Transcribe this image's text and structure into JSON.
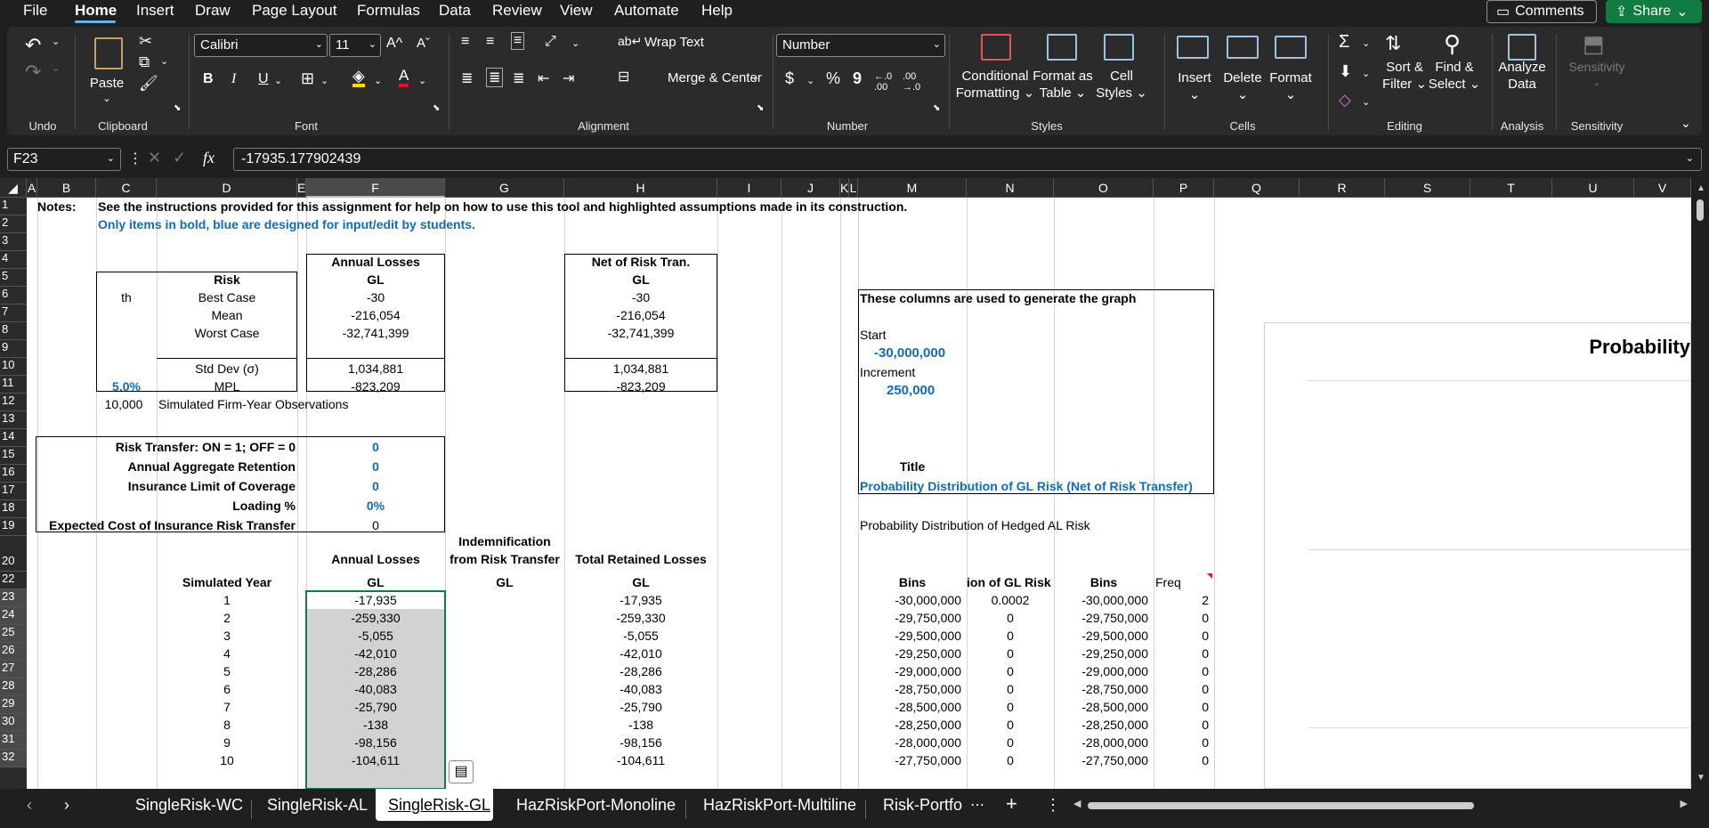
{
  "menu": {
    "items": [
      "File",
      "Home",
      "Insert",
      "Draw",
      "Page Layout",
      "Formulas",
      "Data",
      "Review",
      "View",
      "Automate",
      "Help"
    ],
    "active": "Home"
  },
  "top_buttons": {
    "comments": "Comments",
    "share": "Share"
  },
  "ribbon": {
    "groups": {
      "undo": "Undo",
      "clipboard": "Clipboard",
      "font": "Font",
      "alignment": "Alignment",
      "number": "Number",
      "styles": "Styles",
      "cells": "Cells",
      "editing": "Editing",
      "analysis": "Analysis",
      "sensitivity": "Sensitivity"
    },
    "paste": "Paste",
    "font_name": "Calibri",
    "font_size": "11",
    "bold": "B",
    "italic": "I",
    "underline": "U",
    "wrap_text": "Wrap Text",
    "merge_center": "Merge & Center",
    "number_format": "Number",
    "currency": "$",
    "percent": "%",
    "comma": "9",
    "conditional_formatting": [
      "Conditional",
      "Formatting"
    ],
    "format_as_table": [
      "Format as",
      "Table"
    ],
    "cell_styles": [
      "Cell",
      "Styles"
    ],
    "insert": "Insert",
    "delete": "Delete",
    "format": "Format",
    "sort_filter": [
      "Sort &",
      "Filter"
    ],
    "find_select": [
      "Find &",
      "Select"
    ],
    "analyze_data": [
      "Analyze",
      "Data"
    ],
    "sensitivity": "Sensitivity"
  },
  "formula_bar": {
    "name_box": "F23",
    "fx": "fx",
    "formula": "-17935.177902439"
  },
  "columns": [
    "A",
    "B",
    "C",
    "D",
    "E",
    "F",
    "G",
    "H",
    "I",
    "J",
    "K",
    "L",
    "M",
    "N",
    "O",
    "P",
    "Q",
    "R",
    "S",
    "T",
    "U",
    "V"
  ],
  "rows": [
    "1",
    "2",
    "3",
    "4",
    "5",
    "6",
    "7",
    "8",
    "9",
    "10",
    "11",
    "12",
    "13",
    "14",
    "15",
    "16",
    "17",
    "18",
    "19",
    "20",
    "22",
    "23",
    "24",
    "25",
    "26",
    "27",
    "28",
    "29",
    "30",
    "31",
    "32"
  ],
  "sheet": {
    "notes_label": "Notes:",
    "notes_line1": "See the instructions provided for this assignment  for help on how to use this tool and highlighted assumptions made in its construction.",
    "notes_line2": "Only items in bold, blue are designed for input/edit by  students.",
    "annual_losses": "Annual Losses",
    "gl": "GL",
    "net_risk_tran": "Net of Risk Tran.",
    "risk": "Risk",
    "th": "th",
    "best_case": "Best Case",
    "mean": "Mean",
    "worst_case": "Worst Case",
    "std_dev": "Std Dev (σ)",
    "mpl_pct": "5.0%",
    "mpl": "MPL",
    "best_val": "-30",
    "mean_val": "-216,054",
    "worst_val": "-32,741,399",
    "std_val": "1,034,881",
    "mpl_val": "-823,209",
    "sim_count": "10,000",
    "sim_label": "Simulated Firm-Year Observations",
    "rt_on_off": "Risk Transfer: ON = 1; OFF = 0",
    "aar": "Annual Aggregate Retention",
    "ilc": "Insurance Limit of Coverage",
    "loading": "Loading %",
    "ecirt": "Expected Cost of Insurance Risk Transfer",
    "rt_val": "0",
    "aar_val": "0",
    "ilc_val": "0",
    "loading_val": "0%",
    "ecirt_val": "0",
    "graph_note": "These columns are used to generate the graph",
    "start": "Start",
    "start_val": "-30,000,000",
    "increment": "Increment",
    "increment_val": "250,000",
    "title_label": "Title",
    "title_val": "Probability Distribution of GL Risk (Net of Risk Transfer)",
    "hedged_al": "Probability Distribution of Hedged AL Risk",
    "indemnification": "Indemnification",
    "from_risk_transfer": "from Risk Transfer",
    "total_retained": "Total Retained Losses",
    "simulated_year": "Simulated Year",
    "bins": "Bins",
    "gl_risk_trunc": "ion of GL Risk (",
    "freq": "Freq",
    "chart_title": "Probability"
  },
  "table_rows": [
    {
      "year": "1",
      "annual": "-17,935",
      "total": "-17,935",
      "bin": "-30,000,000",
      "prob": "0.0002",
      "bin2": "-30,000,000",
      "freq": "2"
    },
    {
      "year": "2",
      "annual": "-259,330",
      "total": "-259,330",
      "bin": "-29,750,000",
      "prob": "0",
      "bin2": "-29,750,000",
      "freq": "0"
    },
    {
      "year": "3",
      "annual": "-5,055",
      "total": "-5,055",
      "bin": "-29,500,000",
      "prob": "0",
      "bin2": "-29,500,000",
      "freq": "0"
    },
    {
      "year": "4",
      "annual": "-42,010",
      "total": "-42,010",
      "bin": "-29,250,000",
      "prob": "0",
      "bin2": "-29,250,000",
      "freq": "0"
    },
    {
      "year": "5",
      "annual": "-28,286",
      "total": "-28,286",
      "bin": "-29,000,000",
      "prob": "0",
      "bin2": "-29,000,000",
      "freq": "0"
    },
    {
      "year": "6",
      "annual": "-40,083",
      "total": "-40,083",
      "bin": "-28,750,000",
      "prob": "0",
      "bin2": "-28,750,000",
      "freq": "0"
    },
    {
      "year": "7",
      "annual": "-25,790",
      "total": "-25,790",
      "bin": "-28,500,000",
      "prob": "0",
      "bin2": "-28,500,000",
      "freq": "0"
    },
    {
      "year": "8",
      "annual": "-138",
      "total": "-138",
      "bin": "-28,250,000",
      "prob": "0",
      "bin2": "-28,250,000",
      "freq": "0"
    },
    {
      "year": "9",
      "annual": "-98,156",
      "total": "-98,156",
      "bin": "-28,000,000",
      "prob": "0",
      "bin2": "-28,000,000",
      "freq": "0"
    },
    {
      "year": "10",
      "annual": "-104,611",
      "total": "-104,611",
      "bin": "-27,750,000",
      "prob": "0",
      "bin2": "-27,750,000",
      "freq": "0"
    }
  ],
  "sheet_tabs": [
    "SingleRisk-WC",
    "SingleRisk-AL",
    "SingleRisk-GL",
    "HazRiskPort-Monoline",
    "HazRiskPort-Multiline",
    "Risk-Portfo"
  ],
  "active_sheet": "SingleRisk-GL"
}
